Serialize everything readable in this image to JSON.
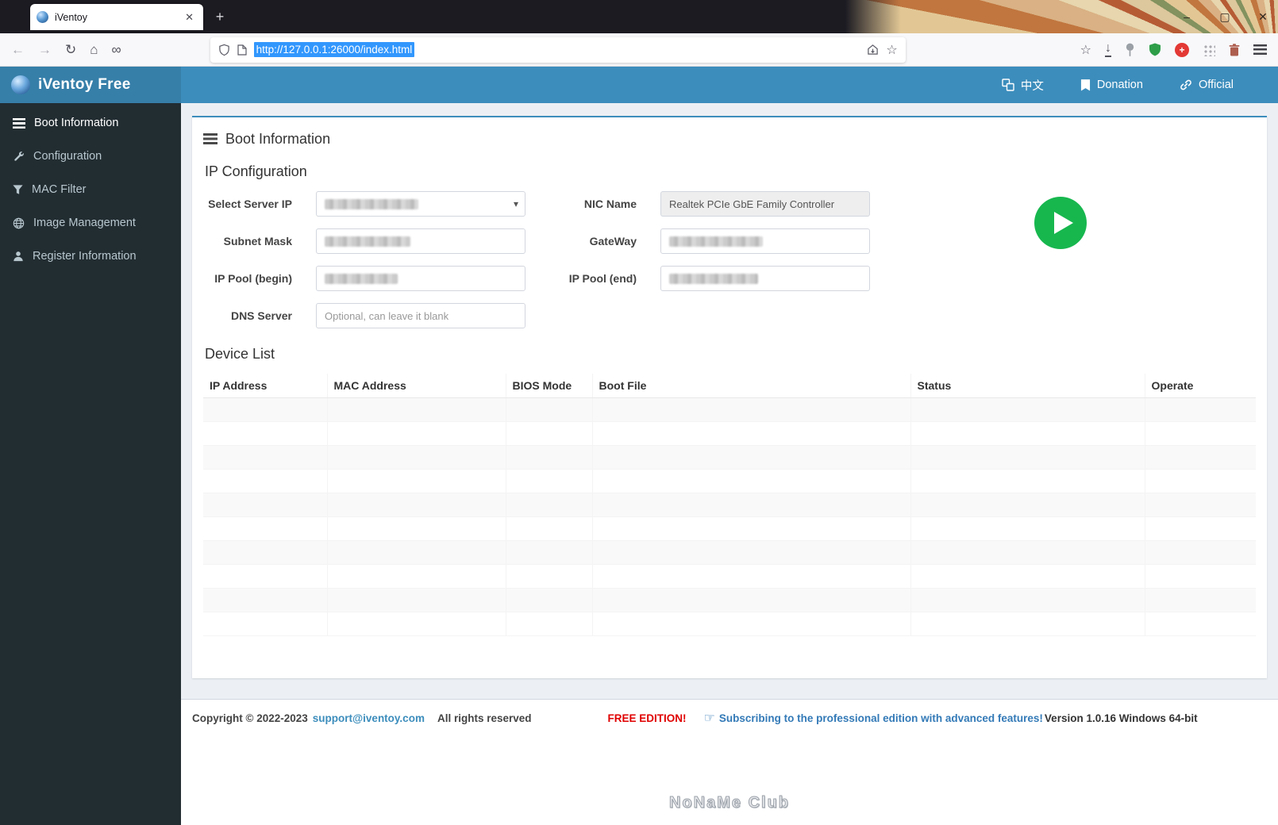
{
  "browser": {
    "tab_title": "iVentoy",
    "url": "http://127.0.0.1:26000/index.html",
    "icons": {
      "back": "←",
      "forward": "→",
      "reload": "↻",
      "home": "⌂",
      "infinity": "∞",
      "bookmark_star": "☆",
      "tab_close": "✕",
      "new_tab": "+",
      "minimize": "–",
      "restore": "▢",
      "window_close": "✕",
      "red_badge": "+"
    }
  },
  "header": {
    "brand": "iVentoy Free",
    "lang": "中文",
    "donation": "Donation",
    "official": "Official"
  },
  "sidebar": {
    "items": [
      {
        "label": "Boot Information"
      },
      {
        "label": "Configuration"
      },
      {
        "label": "MAC Filter"
      },
      {
        "label": "Image Management"
      },
      {
        "label": "Register Information"
      }
    ]
  },
  "main": {
    "title": "Boot Information",
    "ip_config": {
      "heading": "IP Configuration",
      "select_server_ip_label": "Select Server IP",
      "select_chevron": "▾",
      "nic_name_label": "NIC Name",
      "nic_name_value": "Realtek PCIe GbE Family Controller",
      "subnet_mask_label": "Subnet Mask",
      "gateway_label": "GateWay",
      "ip_pool_begin_label": "IP Pool (begin)",
      "ip_pool_end_label": "IP Pool (end)",
      "dns_server_label": "DNS Server",
      "dns_server_placeholder": "Optional, can leave it blank"
    },
    "device_list": {
      "heading": "Device List",
      "columns": [
        "IP Address",
        "MAC Address",
        "BIOS Mode",
        "Boot File",
        "Status",
        "Operate"
      ]
    }
  },
  "footer": {
    "copyright": "Copyright © 2022-2023",
    "email": "support@iventoy.com",
    "rights": "All rights reserved",
    "edition": "FREE EDITION!",
    "hand_icon": "☞",
    "subscribe": "Subscribing to the professional edition with advanced features!",
    "version": "Version 1.0.16 Windows 64-bit"
  },
  "watermark": "NoNaMe Club",
  "colors": {
    "header_blue": "#3c8dbc",
    "brand_blue": "#367fa9",
    "sidebar_dark": "#222d32",
    "content_bg": "#ecf0f5",
    "accent_green": "#17b74e",
    "edition_red": "#e00000",
    "link_blue": "#337ab7"
  }
}
